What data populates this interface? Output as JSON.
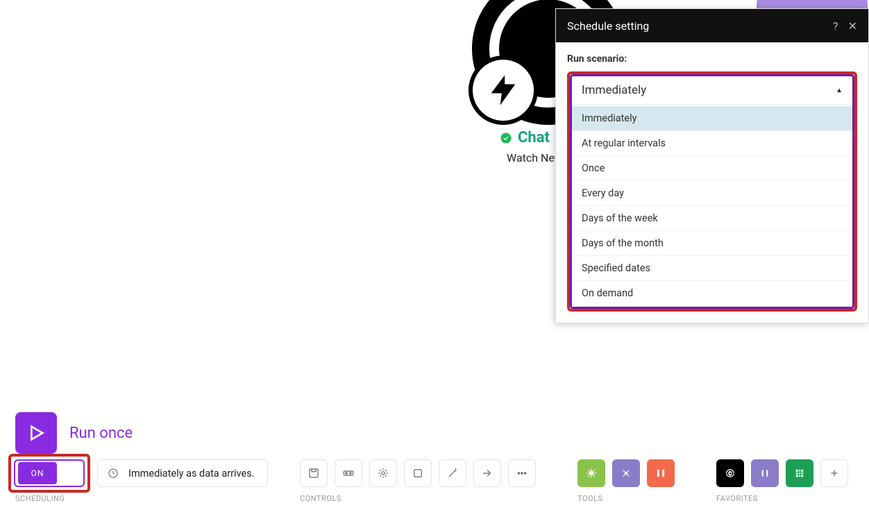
{
  "scenario": {
    "name": "Chat",
    "subtitle": "Watch New"
  },
  "dialog": {
    "title": "Schedule setting",
    "field_label": "Run scenario:",
    "selected": "Immediately",
    "options": [
      "Immediately",
      "At regular intervals",
      "Once",
      "Every day",
      "Days of the week",
      "Days of the month",
      "Specified dates",
      "On demand"
    ]
  },
  "footer": {
    "run_label": "Run once",
    "toggle": "ON",
    "schedule_hint": "Immediately as data arrives.",
    "sections": {
      "scheduling": "SCHEDULING",
      "controls": "CONTROLS",
      "tools": "TOOLS",
      "favorites": "FAVORITES"
    }
  }
}
